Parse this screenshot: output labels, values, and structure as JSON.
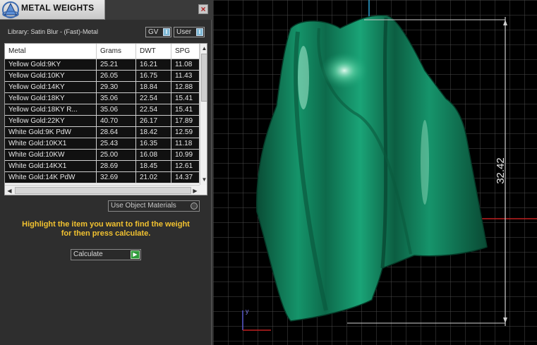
{
  "panel": {
    "title": "METAL WEIGHTS",
    "close_glyph": "×",
    "library_label": "Library: Satin Blur - (Fast)-Metal",
    "toggle_gv": "GV",
    "toggle_user": "User",
    "columns": [
      "Metal",
      "Grams",
      "DWT",
      "SPG"
    ],
    "rows": [
      [
        "Yellow Gold:9KY",
        "25.21",
        "16.21",
        "11.08"
      ],
      [
        "Yellow Gold:10KY",
        "26.05",
        "16.75",
        "11.43"
      ],
      [
        "Yellow Gold:14KY",
        "29.30",
        "18.84",
        "12.88"
      ],
      [
        "Yellow Gold:18KY",
        "35.06",
        "22.54",
        "15.41"
      ],
      [
        "Yellow Gold:18KY R...",
        "35.06",
        "22.54",
        "15.41"
      ],
      [
        "Yellow Gold:22KY",
        "40.70",
        "26.17",
        "17.89"
      ],
      [
        "White Gold:9K PdW",
        "28.64",
        "18.42",
        "12.59"
      ],
      [
        "White Gold:10KX1",
        "25.43",
        "16.35",
        "11.18"
      ],
      [
        "White Gold:10KW",
        "25.00",
        "16.08",
        "10.99"
      ],
      [
        "White Gold:14KX1",
        "28.69",
        "18.45",
        "12.61"
      ],
      [
        "White Gold:14K PdW",
        "32.69",
        "21.02",
        "14.37"
      ]
    ],
    "use_object_materials": "Use Object Materials",
    "hint_line1": "Highlight the item you want to find the weight",
    "hint_line2": "for then press calculate.",
    "calculate_label": "Calculate"
  },
  "viewport": {
    "dimension_label": "32.42",
    "axis_y_label": "y",
    "model_color": "#12805a"
  }
}
